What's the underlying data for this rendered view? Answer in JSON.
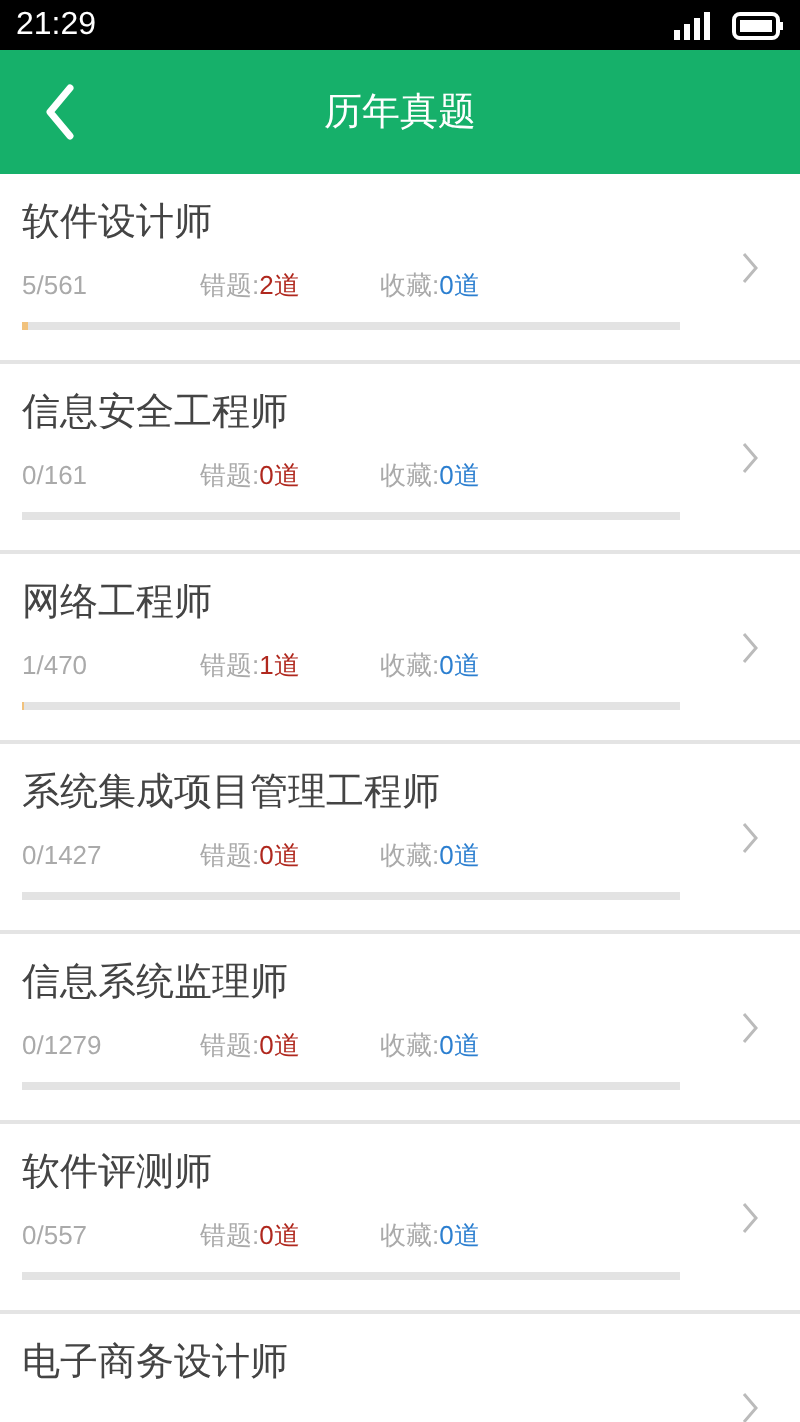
{
  "status_bar": {
    "time": "21:29"
  },
  "header": {
    "title": "历年真题"
  },
  "items": [
    {
      "name": "软件设计师",
      "progress": "5/561",
      "level": 0.009,
      "wrong_label": "错题:",
      "wrong": "2道",
      "fav_label": "收藏:",
      "fav": "0道"
    },
    {
      "name": "信息安全工程师",
      "progress": "0/161",
      "level": 0,
      "wrong_label": "错题:",
      "wrong": "0道",
      "fav_label": "收藏:",
      "fav": "0道"
    },
    {
      "name": "网络工程师",
      "progress": "1/470",
      "level": 0.002,
      "wrong_label": "错题:",
      "wrong": "1道",
      "fav_label": "收藏:",
      "fav": "0道"
    },
    {
      "name": "系统集成项目管理工程师",
      "progress": "0/1427",
      "level": 0,
      "wrong_label": "错题:",
      "wrong": "0道",
      "fav_label": "收藏:",
      "fav": "0道"
    },
    {
      "name": "信息系统监理师",
      "progress": "0/1279",
      "level": 0,
      "wrong_label": "错题:",
      "wrong": "0道",
      "fav_label": "收藏:",
      "fav": "0道"
    },
    {
      "name": "软件评测师",
      "progress": "0/557",
      "level": 0,
      "wrong_label": "错题:",
      "wrong": "0道",
      "fav_label": "收藏:",
      "fav": "0道"
    },
    {
      "name": "电子商务设计师"
    }
  ]
}
